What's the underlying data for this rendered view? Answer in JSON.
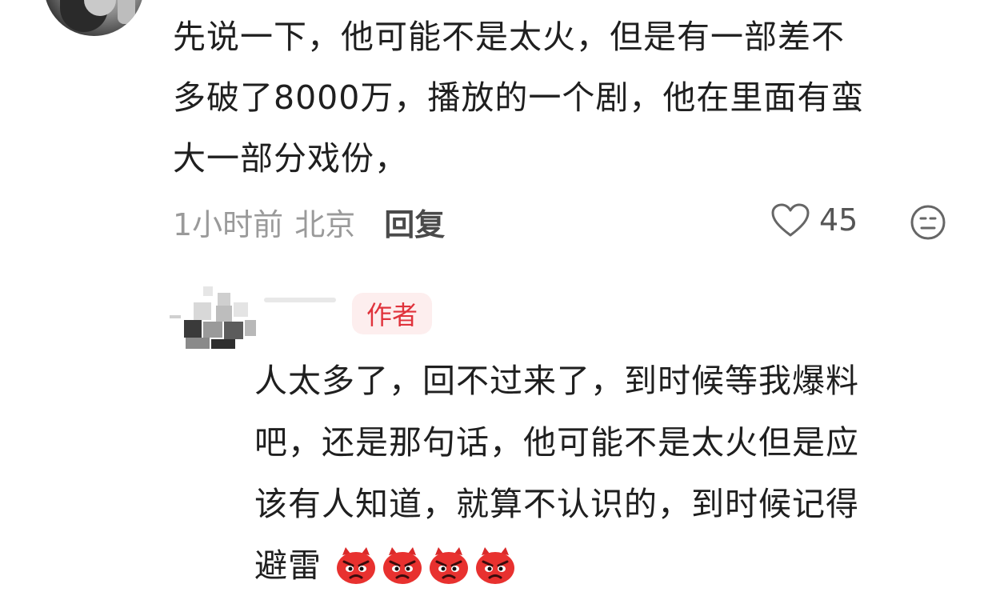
{
  "comment": {
    "text": "先说一下，他可能不是太火，但是有一部差不\n多破了8000万，播放的一个剧，他在里面有蛮\n大一部分戏份，",
    "time": "1小时前",
    "location": "北京",
    "reply_label": "回复",
    "like_count": "45"
  },
  "author_reply": {
    "badge": "作者",
    "text": "人太多了，回不过来了，到时候等我爆料\n吧，还是那句话，他可能不是太火但是应\n该有人知道，就算不认识的，到时候记得\n避雷",
    "emoji_count": 4,
    "emoji_icon": "angry-face-icon"
  },
  "colors": {
    "badge_bg": "#fdeeee",
    "badge_text": "#e0333c",
    "meta_text": "#9a9a9a",
    "emoji_red": "#e8312f"
  }
}
